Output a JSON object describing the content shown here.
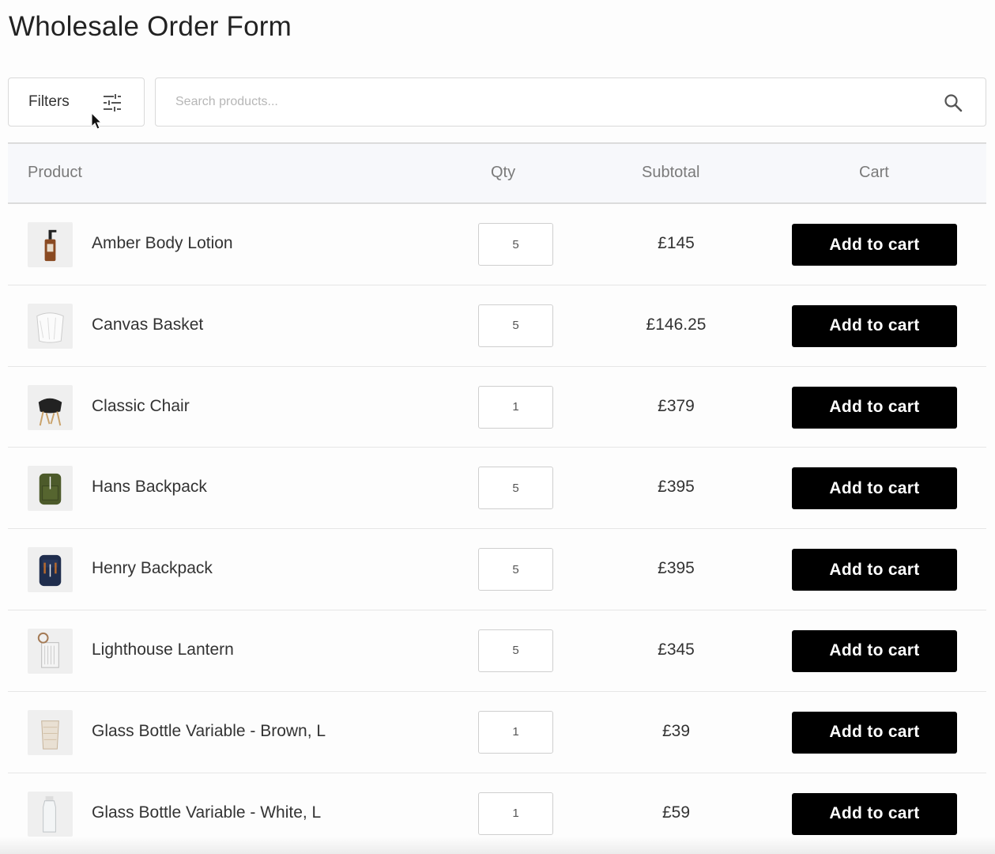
{
  "page": {
    "title": "Wholesale Order Form"
  },
  "toolbar": {
    "filters_label": "Filters",
    "filters_icon": "sliders-icon",
    "search_placeholder": "Search products...",
    "search_value": "",
    "search_icon": "search-icon"
  },
  "table": {
    "headers": {
      "product": "Product",
      "qty": "Qty",
      "subtotal": "Subtotal",
      "cart": "Cart"
    },
    "rows": [
      {
        "name": "Amber Body Lotion",
        "qty": "5",
        "subtotal": "£145",
        "button": "Add to cart",
        "thumb": "lotion-bottle-icon"
      },
      {
        "name": "Canvas Basket",
        "qty": "5",
        "subtotal": "£146.25",
        "button": "Add to cart",
        "thumb": "basket-icon"
      },
      {
        "name": "Classic Chair",
        "qty": "1",
        "subtotal": "£379",
        "button": "Add to cart",
        "thumb": "chair-icon"
      },
      {
        "name": "Hans Backpack",
        "qty": "5",
        "subtotal": "£395",
        "button": "Add to cart",
        "thumb": "green-backpack-icon"
      },
      {
        "name": "Henry Backpack",
        "qty": "5",
        "subtotal": "£395",
        "button": "Add to cart",
        "thumb": "navy-backpack-icon"
      },
      {
        "name": "Lighthouse Lantern",
        "qty": "5",
        "subtotal": "£345",
        "button": "Add to cart",
        "thumb": "lantern-icon"
      },
      {
        "name": "Glass Bottle Variable - Brown, L",
        "qty": "1",
        "subtotal": "£39",
        "button": "Add to cart",
        "thumb": "brown-glass-icon"
      },
      {
        "name": "Glass Bottle Variable - White, L",
        "qty": "1",
        "subtotal": "£59",
        "button": "Add to cart",
        "thumb": "clear-bottle-icon"
      }
    ]
  },
  "colors": {
    "button_bg": "#000000",
    "button_text": "#ffffff",
    "header_bg": "#f7f8fb",
    "border": "#dcdcdc"
  }
}
